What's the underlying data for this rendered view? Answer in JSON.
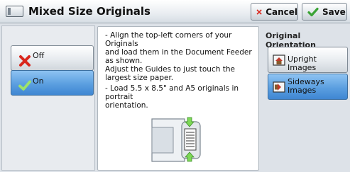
{
  "header": {
    "title": "Mixed Size Originals",
    "cancel_label": "Cancel",
    "save_label": "Save"
  },
  "options": [
    {
      "label": "Off",
      "selected": false,
      "icon": "red-x-icon"
    },
    {
      "label": "On",
      "selected": true,
      "icon": "green-check-icon"
    }
  ],
  "info": {
    "paragraph1": "- Align the top-left corners of your Originals\n  and load them in the Document Feeder\n  as shown.\n  Adjust the Guides to just touch the\n  largest size paper.",
    "paragraph2": "- Load 5.5 x 8.5\" and A5 originals in portrait\n  orientation."
  },
  "orientation": {
    "label": "Original Orientation",
    "items": [
      {
        "label": "Upright Images",
        "selected": false,
        "icon": "upright-image-icon"
      },
      {
        "label": "Sideways\nImages",
        "selected": true,
        "icon": "sideways-image-icon"
      }
    ]
  },
  "colors": {
    "selected_blue": "#5b9fe0",
    "cancel_red": "#d9261c",
    "save_green": "#3aa335"
  }
}
